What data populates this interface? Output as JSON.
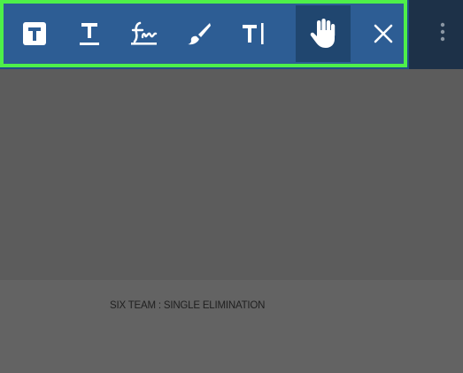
{
  "toolbar": {
    "tools": [
      {
        "id": "text-box",
        "icon": "text-box-icon"
      },
      {
        "id": "underline-text",
        "icon": "underline-text-icon"
      },
      {
        "id": "signature",
        "icon": "signature-icon"
      },
      {
        "id": "brush",
        "icon": "brush-icon"
      },
      {
        "id": "text-cursor",
        "icon": "text-cursor-icon"
      },
      {
        "id": "hand",
        "icon": "hand-icon",
        "active": true
      },
      {
        "id": "close",
        "icon": "close-icon"
      }
    ],
    "overflow_icon": "more-vertical-icon",
    "highlight_color": "#4ef04a",
    "toolbar_color": "#2d5d94"
  },
  "document": {
    "title": "SIX TEAM : SINGLE ELIMINATION"
  }
}
